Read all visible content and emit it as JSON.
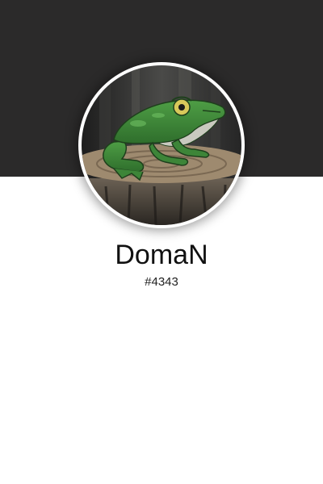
{
  "profile": {
    "banner_color": "#2b2a2a",
    "background_color": "#ffffff",
    "avatar": "frog-on-stump-avatar",
    "username": "DomaN",
    "discriminator": "#4343"
  }
}
